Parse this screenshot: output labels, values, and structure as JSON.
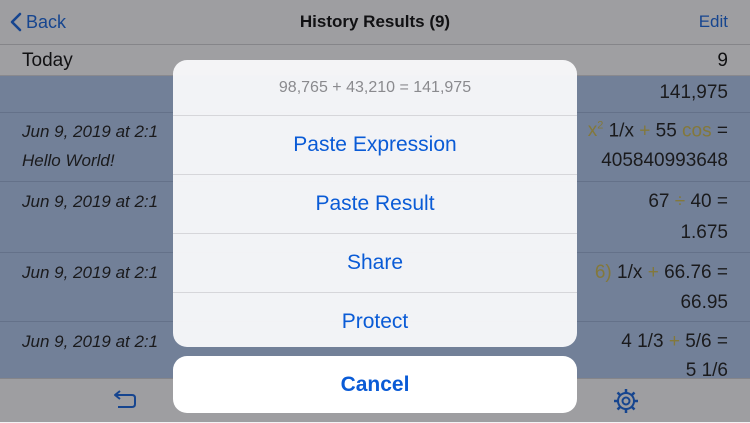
{
  "navbar": {
    "back_label": "Back",
    "title": "History Results (9)",
    "edit_label": "Edit"
  },
  "section": {
    "title": "Today",
    "count": "9"
  },
  "rows": [
    {
      "result": "141,975"
    },
    {
      "date": "Jun 9, 2019 at 2:1",
      "note": "Hello World!",
      "expr_tail": "1/x",
      "expr_num": "55",
      "result": "40584099364​8"
    },
    {
      "date": "Jun 9, 2019 at 2:1",
      "expr_a": "67",
      "expr_op": "÷",
      "expr_b": "40 =",
      "result": "1.675"
    },
    {
      "date": "Jun 9, 2019 at 2:1",
      "expr_a": "6)",
      "expr_b": "1/x",
      "expr_op": "+",
      "expr_c": "66.76 =",
      "result": "66.95"
    },
    {
      "date": "Jun 9, 2019 at 2:1",
      "expr_a": "4 1/3",
      "expr_op": "+",
      "expr_b": "5/6 =",
      "result": "5 1/6"
    }
  ],
  "action_sheet": {
    "title": "98,765 + 43,210 = 141,975",
    "actions": [
      "Paste Expression",
      "Paste Result",
      "Share",
      "Protect"
    ],
    "cancel_label": "Cancel"
  },
  "toolbar": {
    "icons": [
      "undo-icon",
      "gear-icon"
    ]
  }
}
